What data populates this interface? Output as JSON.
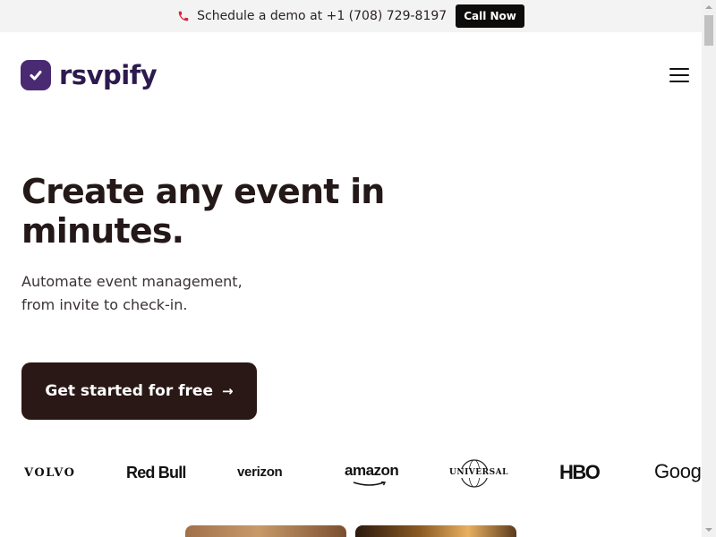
{
  "topbar": {
    "announcement": "Schedule a demo at +1 (708) 729-8197",
    "call_label": "Call Now",
    "phone_icon": "phone-icon",
    "phone_icon_color": "#d8243a"
  },
  "header": {
    "logo_text": "rsvpify",
    "logo_color": "#4a2a73",
    "menu_icon": "hamburger-menu-icon"
  },
  "hero": {
    "headline": "Create any event in minutes.",
    "subtext_line1": "Automate event management,",
    "subtext_line2": "from invite to check-in.",
    "cta_label": "Get started for free",
    "cta_arrow": "→",
    "cta_color": "#2a1816"
  },
  "brands": {
    "volvo": "VOLVO",
    "redbull": "Red Bull",
    "verizon": "verizon",
    "amazon": "amazon",
    "universal": "UNIVERSAL",
    "hbo": "HBO",
    "google": "Goog"
  }
}
